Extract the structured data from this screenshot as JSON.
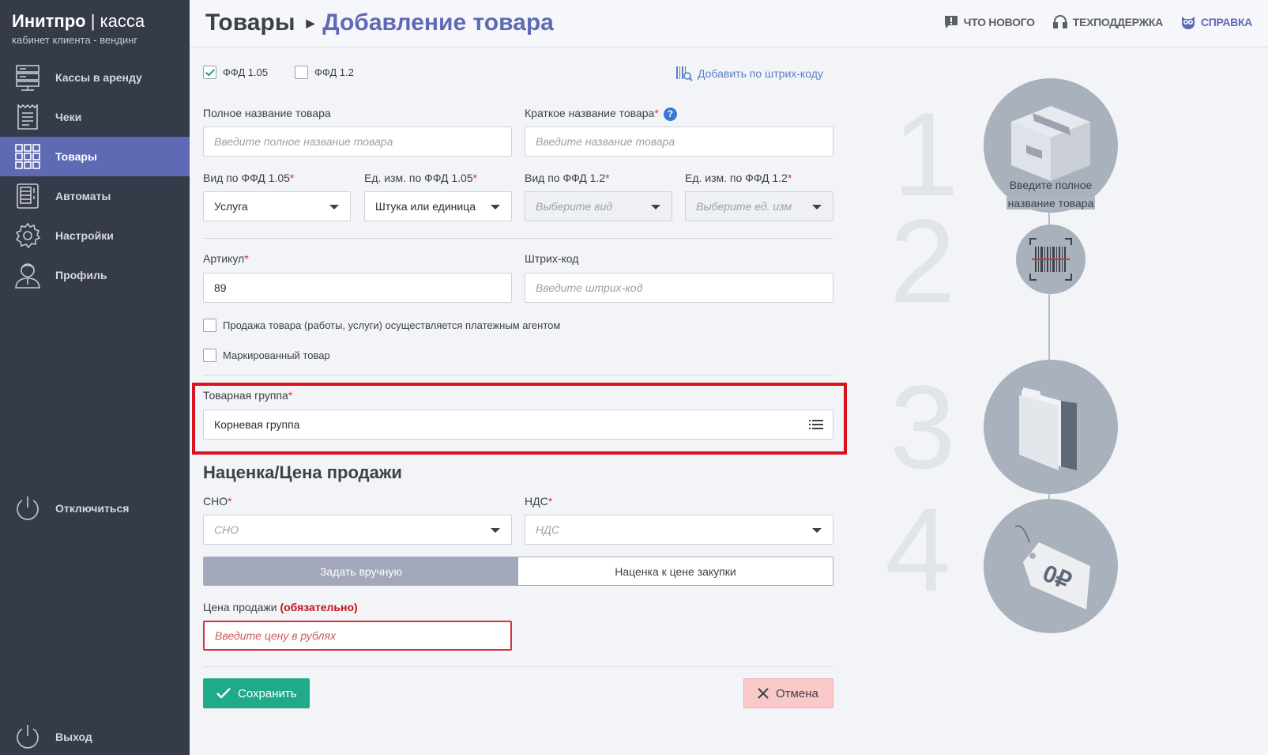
{
  "brand": {
    "name": "Инитпро",
    "separator": "|",
    "product": "касса",
    "subtitle": "кабинет клиента - вендинг"
  },
  "sidebar": {
    "items": [
      {
        "label": "Кассы в аренду",
        "icon": "server-icon",
        "active": false
      },
      {
        "label": "Чеки",
        "icon": "receipt-icon",
        "active": false
      },
      {
        "label": "Товары",
        "icon": "grid-icon",
        "active": true
      },
      {
        "label": "Автоматы",
        "icon": "vending-machine-icon",
        "active": false
      },
      {
        "label": "Настройки",
        "icon": "gear-icon",
        "active": false
      },
      {
        "label": "Профиль",
        "icon": "user-icon",
        "active": false
      }
    ],
    "disconnect": "Отключиться",
    "logout": "Выход"
  },
  "header": {
    "crumb_root": "Товары",
    "crumb_current": "Добавление товара",
    "links": {
      "whats_new": "ЧТО НОВОГО",
      "support": "ТЕХПОДДЕРЖКА",
      "help": "СПРАВКА"
    }
  },
  "form": {
    "ffd_105": {
      "label": "ФФД 1.05",
      "checked": true
    },
    "ffd_12": {
      "label": "ФФД 1.2",
      "checked": false
    },
    "add_by_barcode": "Добавить по штрих-коду",
    "full_name": {
      "label": "Полное название товара",
      "placeholder": "Введите полное название товара"
    },
    "short_name": {
      "label": "Краткое название товара",
      "placeholder": "Введите название товара",
      "help": "?"
    },
    "type_105": {
      "label": "Вид по ФФД 1.05",
      "value": "Услуга"
    },
    "unit_105": {
      "label": "Ед. изм. по ФФД 1.05",
      "value": "Штука или единица"
    },
    "type_12": {
      "label": "Вид по ФФД 1.2",
      "placeholder": "Выберите вид"
    },
    "unit_12": {
      "label": "Ед. изм. по ФФД 1.2",
      "placeholder": "Выберите ед. изм"
    },
    "article": {
      "label": "Артикул",
      "value": "89"
    },
    "barcode": {
      "label": "Штрих-код",
      "placeholder": "Введите штрих-код"
    },
    "payment_agent": {
      "label": "Продажа товара (работы, услуги) осуществляется платежным агентом",
      "checked": false
    },
    "marked": {
      "label": "Маркированный товар",
      "checked": false
    },
    "group": {
      "label": "Товарная группа",
      "value": "Корневая группа"
    },
    "markup_section": "Наценка/Цена продажи",
    "sno": {
      "label": "СНО",
      "placeholder": "СНО"
    },
    "nds": {
      "label": "НДС",
      "placeholder": "НДС"
    },
    "price_mode": {
      "manual": "Задать вручную",
      "markup": "Наценка к цене закупки",
      "selected": "manual"
    },
    "sale_price": {
      "label": "Цена продажи",
      "mandatory": "(обязательно)",
      "placeholder": "Введите цену в рублях"
    },
    "save": "Сохранить",
    "cancel": "Отмена",
    "required_mark": "*"
  },
  "steps": {
    "numbers": [
      "1",
      "2",
      "3",
      "4"
    ],
    "caption_line1": "Введите полное",
    "caption_line2": "название товара",
    "price_tag": "0₽"
  },
  "colors": {
    "accent": "#5f6ab4",
    "sidebar": "#363b49",
    "save": "#1faa8a",
    "cancel": "#f9c8c8",
    "error": "#d8313a"
  }
}
